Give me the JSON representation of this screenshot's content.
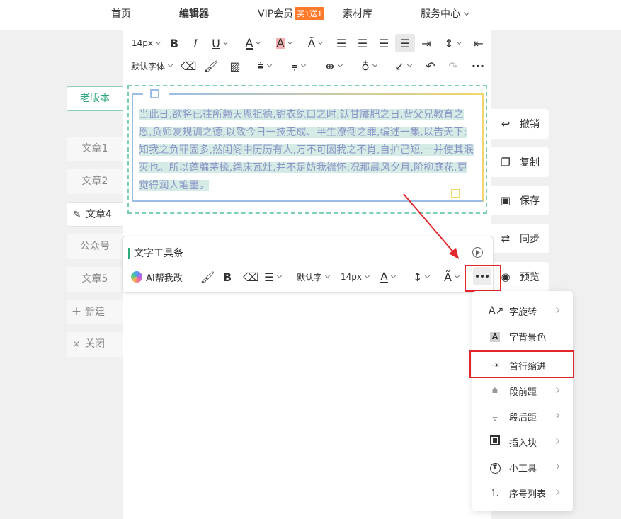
{
  "nav": {
    "items": [
      "首页",
      "编辑器",
      "VIP会员",
      "素材库",
      "服务中心"
    ],
    "vip_badge": "买1送1"
  },
  "toolbar": {
    "font_size": "14px",
    "font_family": "默认字体"
  },
  "content": {
    "text": "当此日,欲将已往所赖天恩祖德,锦衣纨口之时,饫甘餍肥之日,背父兄教育之恩,负师友规训之德,以致今日一技无成、半生潦倒之罪,编述一集,以告天下;知我之负罪固多,然闺阁中历历有人,万不可因我之不肖,自护己短,一并使其泯灭也。所以蓬牖茅椽,绳床瓦灶,并不足妨我襟怀:况那晨风夕月,阶柳庭花,更觉得润人笔墨。"
  },
  "sidebar": {
    "old_version": "老版本",
    "items": [
      "文章1",
      "文章2",
      "文章4",
      "公众号",
      "文章5"
    ],
    "new_label": "新建",
    "close_label": "关闭"
  },
  "actions": [
    "撤销",
    "复制",
    "保存",
    "同步",
    "预览"
  ],
  "text_toolbar": {
    "title": "文字工具条",
    "ai_label": "AI帮我改",
    "font_family": "默认字",
    "font_size": "14px"
  },
  "more_menu": {
    "items": [
      {
        "label": "字旋转",
        "icon": "text-rotate-icon",
        "has_sub": true
      },
      {
        "label": "字背景色",
        "icon": "text-background-icon",
        "has_sub": false
      },
      {
        "label": "首行缩进",
        "icon": "first-line-indent-icon",
        "has_sub": false
      },
      {
        "label": "段前距",
        "icon": "space-before-icon",
        "has_sub": true
      },
      {
        "label": "段后距",
        "icon": "space-after-icon",
        "has_sub": true
      },
      {
        "label": "插入块",
        "icon": "insert-block-icon",
        "has_sub": true
      },
      {
        "label": "小工具",
        "icon": "tools-icon",
        "has_sub": true
      },
      {
        "label": "序号列表",
        "icon": "numbered-list-icon",
        "has_sub": true
      }
    ]
  },
  "colors": {
    "accent_green": "#2faa7a",
    "highlight_red": "#e3262c",
    "text_purple": "#8d94c6",
    "selection_bg": "#d5ece6"
  }
}
